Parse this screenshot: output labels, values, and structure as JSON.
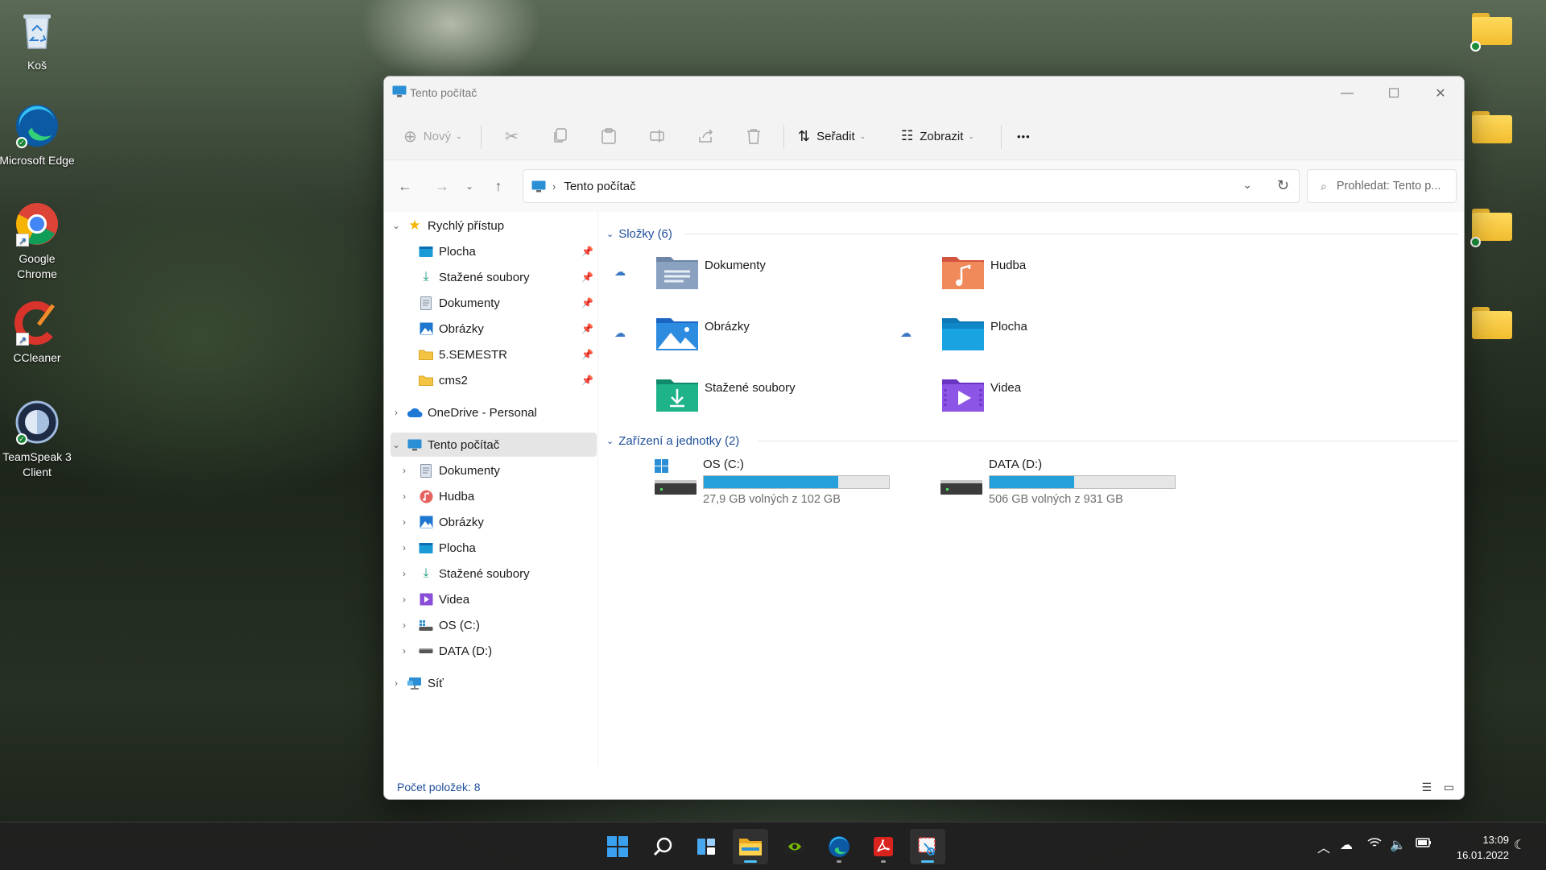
{
  "desktop": {
    "icons": [
      {
        "label": "Koš"
      },
      {
        "label": "Microsoft Edge"
      },
      {
        "label": "Google Chrome"
      },
      {
        "label": "CCleaner"
      },
      {
        "label": "TeamSpeak 3 Client"
      }
    ]
  },
  "window": {
    "title": "Tento počítač",
    "controls": {
      "minimize": "—",
      "maximize": "☐",
      "close": "✕"
    }
  },
  "toolbar": {
    "new_label": "Nový",
    "sort_label": "Seřadit",
    "view_label": "Zobrazit",
    "more_label": "•••"
  },
  "address": {
    "crumb": "Tento počítač",
    "search_placeholder": "Prohledat: Tento p..."
  },
  "sidebar": {
    "quick_access": {
      "label": "Rychlý přístup",
      "items": [
        {
          "label": "Plocha",
          "icon": "desktop-icon"
        },
        {
          "label": "Stažené soubory",
          "icon": "download-icon"
        },
        {
          "label": "Dokumenty",
          "icon": "document-icon"
        },
        {
          "label": "Obrázky",
          "icon": "image-icon"
        },
        {
          "label": "5.SEMESTR",
          "icon": "folder-icon"
        },
        {
          "label": "cms2",
          "icon": "folder-icon"
        }
      ]
    },
    "onedrive": {
      "label": "OneDrive - Personal"
    },
    "this_pc": {
      "label": "Tento počítač",
      "items": [
        {
          "label": "Dokumenty"
        },
        {
          "label": "Hudba"
        },
        {
          "label": "Obrázky"
        },
        {
          "label": "Plocha"
        },
        {
          "label": "Stažené soubory"
        },
        {
          "label": "Videa"
        },
        {
          "label": "OS (C:)"
        },
        {
          "label": "DATA (D:)"
        }
      ]
    },
    "network": {
      "label": "Síť"
    }
  },
  "content": {
    "folders_header": "Složky (6)",
    "folders": [
      {
        "label": "Dokumenty",
        "cloud": true
      },
      {
        "label": "Hudba",
        "cloud": false
      },
      {
        "label": "Obrázky",
        "cloud": true
      },
      {
        "label": "Plocha",
        "cloud": true
      },
      {
        "label": "Stažené soubory",
        "cloud": false
      },
      {
        "label": "Videa",
        "cloud": false
      }
    ],
    "drives_header": "Zařízení a jednotky (2)",
    "drives": [
      {
        "name": "OS (C:)",
        "info": "27,9 GB volných z 102 GB",
        "used_fraction": 0.727
      },
      {
        "name": "DATA (D:)",
        "info": "506 GB volných z 931 GB",
        "used_fraction": 0.456
      }
    ]
  },
  "status": {
    "count": "Počet položek: 8"
  },
  "taskbar": {
    "clock_time": "13:09",
    "clock_date": "16.01.2022"
  },
  "colors": {
    "accent": "#26a0da",
    "group_header": "#1f4e99",
    "taskbar": "#202020"
  }
}
